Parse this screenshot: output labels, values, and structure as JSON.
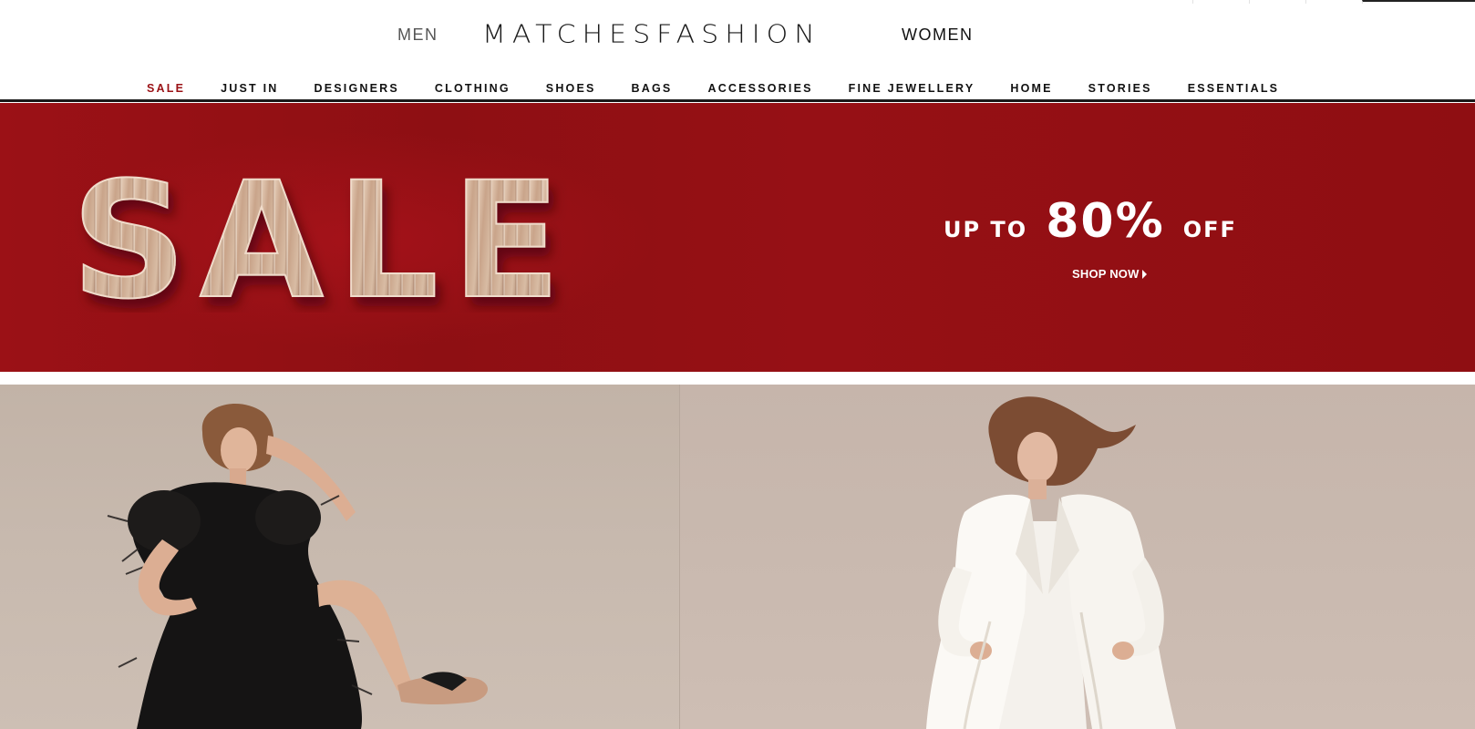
{
  "header": {
    "logo_text": "MATCHESFASHION",
    "gender_men": "MEN",
    "gender_women": "WOMEN"
  },
  "nav": {
    "items": [
      {
        "label": "SALE",
        "highlight": true
      },
      {
        "label": "JUST IN"
      },
      {
        "label": "DESIGNERS"
      },
      {
        "label": "CLOTHING"
      },
      {
        "label": "SHOES"
      },
      {
        "label": "BAGS"
      },
      {
        "label": "ACCESSORIES"
      },
      {
        "label": "FINE JEWELLERY"
      },
      {
        "label": "HOME"
      },
      {
        "label": "STORIES"
      },
      {
        "label": "ESSENTIALS"
      }
    ]
  },
  "banner": {
    "art_text": "SALE",
    "offer_prefix": "UP TO",
    "offer_percent": "80%",
    "offer_suffix": "OFF",
    "cta": "SHOP NOW",
    "background_color": "#921014"
  },
  "colors": {
    "sale_red": "#9a1115",
    "nav_rule": "#1a1a1a"
  },
  "panels": [
    {
      "name": "model-black-feather-dress"
    },
    {
      "name": "model-white-suit"
    }
  ]
}
